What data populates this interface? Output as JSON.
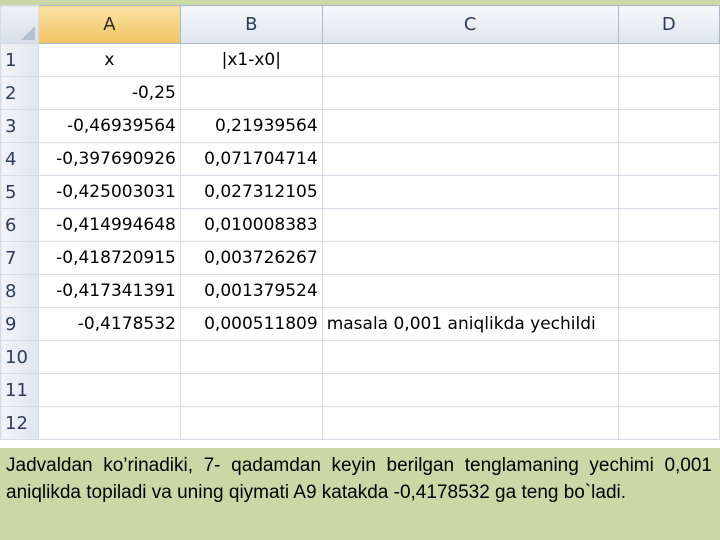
{
  "spreadsheet": {
    "columns": [
      "A",
      "B",
      "C",
      "D"
    ],
    "active_column": "A",
    "rows": [
      {
        "n": "1",
        "a": "x",
        "b": "|x1-x0|",
        "c": ""
      },
      {
        "n": "2",
        "a": "-0,25",
        "b": "",
        "c": ""
      },
      {
        "n": "3",
        "a": "-0,46939564",
        "b": "0,21939564",
        "c": ""
      },
      {
        "n": "4",
        "a": "-0,397690926",
        "b": "0,071704714",
        "c": ""
      },
      {
        "n": "5",
        "a": "-0,425003031",
        "b": "0,027312105",
        "c": ""
      },
      {
        "n": "6",
        "a": "-0,414994648",
        "b": "0,010008383",
        "c": ""
      },
      {
        "n": "7",
        "a": "-0,418720915",
        "b": "0,003726267",
        "c": ""
      },
      {
        "n": "8",
        "a": "-0,417341391",
        "b": "0,001379524",
        "c": ""
      },
      {
        "n": "9",
        "a": "-0,4178532",
        "b": "0,000511809",
        "c": "masala 0,001 aniqlikda yechildi"
      },
      {
        "n": "10",
        "a": "",
        "b": "",
        "c": ""
      },
      {
        "n": "11",
        "a": "",
        "b": "",
        "c": ""
      },
      {
        "n": "12",
        "a": "",
        "b": "",
        "c": ""
      }
    ]
  },
  "caption": "Jadvaldan ko’rinadiki, 7- qadamdan keyin berilgan tenglamaning yechimi 0,001 aniqlikda topiladi va uning qiymati A9 katakda -0,4178532 ga teng bo`ladi."
}
